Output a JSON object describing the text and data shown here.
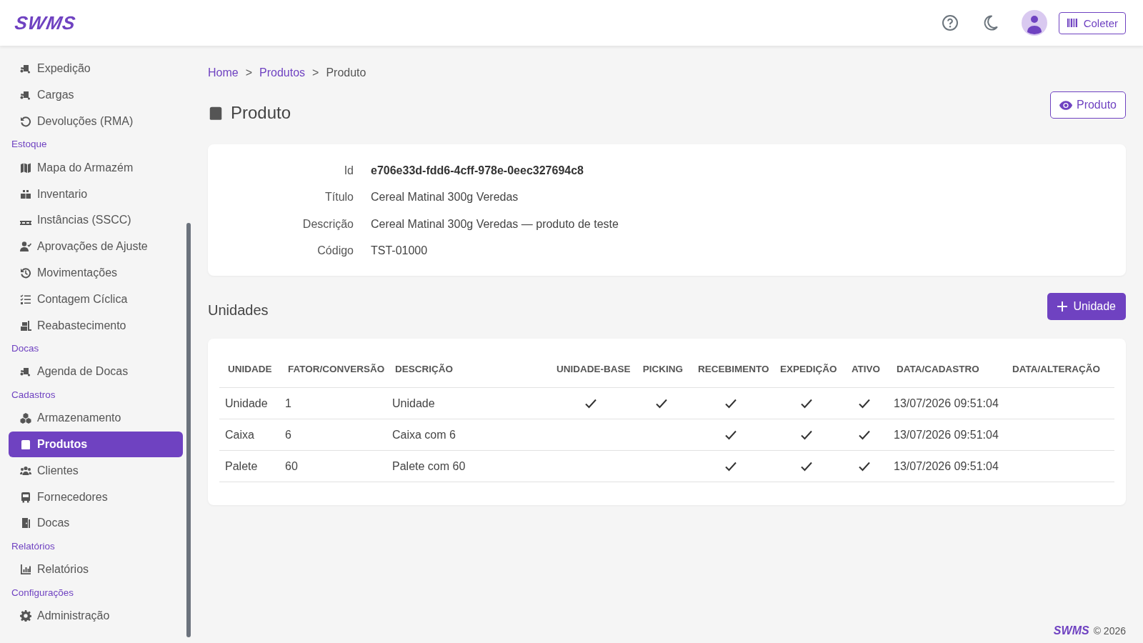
{
  "header": {
    "logo": "SWMS",
    "collector_button": "Coleter"
  },
  "sidebar": {
    "groups": [
      {
        "items": [
          {
            "label": "Expedição",
            "selected": false
          },
          {
            "label": "Cargas",
            "selected": false
          },
          {
            "label": "Devoluções (RMA)",
            "selected": false
          }
        ]
      },
      {
        "title": "Estoque",
        "items": [
          {
            "label": "Mapa do Armazém",
            "selected": false
          },
          {
            "label": "Inventario",
            "selected": false
          },
          {
            "label": "Instâncias (SSCC)",
            "selected": false
          },
          {
            "label": "Aprovações de Ajuste",
            "selected": false
          },
          {
            "label": "Movimentações",
            "selected": false
          },
          {
            "label": "Contagem Cíclica",
            "selected": false
          },
          {
            "label": "Reabastecimento",
            "selected": false
          }
        ]
      },
      {
        "title": "Docas",
        "items": [
          {
            "label": "Agenda de Docas",
            "selected": false
          }
        ]
      },
      {
        "title": "Cadastros",
        "items": [
          {
            "label": "Armazenamento",
            "selected": false
          },
          {
            "label": "Produtos",
            "selected": true
          },
          {
            "label": "Clientes",
            "selected": false
          },
          {
            "label": "Fornecedores",
            "selected": false
          },
          {
            "label": "Docas",
            "selected": false
          }
        ]
      },
      {
        "title": "Relatórios",
        "items": [
          {
            "label": "Relatórios",
            "selected": false
          }
        ]
      },
      {
        "title": "Configurações",
        "items": [
          {
            "label": "Administração",
            "selected": false
          }
        ]
      }
    ]
  },
  "breadcrumb": [
    {
      "kind": "link",
      "text": "Home"
    },
    {
      "kind": "separator",
      "text": ">"
    },
    {
      "kind": "link",
      "text": "Produtos"
    },
    {
      "kind": "separator",
      "text": ">"
    },
    {
      "kind": "current",
      "text": "Produto"
    }
  ],
  "page": {
    "title": "Produto",
    "view_button": "Produto"
  },
  "details": [
    {
      "label": "Id",
      "value": "e706e33d-fdd6-4cff-978e-0eec327694c8",
      "kind": "strong"
    },
    {
      "label": "Título",
      "value": "Cereal Matinal 300g Veredas",
      "kind": "plain"
    },
    {
      "label": "Descrição",
      "value": "Cereal Matinal 300g Veredas — produto de teste",
      "kind": "plain"
    },
    {
      "label": "Código",
      "value": "TST-01000",
      "kind": "plain"
    }
  ],
  "units": {
    "title": "Unidades",
    "add_button": "Unidade"
  },
  "table": {
    "columns": [
      "UNIDADE",
      "FATOR/CONVERSÃO",
      "DESCRIÇÃO",
      "UNIDADE-BASE",
      "PICKING",
      "RECEBIMENTO",
      "EXPEDIÇÃO",
      "ATIVO",
      "DATA/CADASTRO",
      "DATA/ALTERAÇÃO"
    ],
    "rows": [
      {
        "unidade": "Unidade",
        "fator": "1",
        "descricao": "Unidade",
        "unidade_base": true,
        "picking": true,
        "recebimento": true,
        "expedicao": true,
        "ativo": true,
        "data_cadastro": "13/07/2026 09:51:04"
      },
      {
        "unidade": "Caixa",
        "fator": "6",
        "descricao": "Caixa com 6",
        "unidade_base": false,
        "picking": false,
        "recebimento": true,
        "expedicao": true,
        "ativo": true,
        "data_cadastro": "13/07/2026 09:51:04"
      },
      {
        "unidade": "Palete",
        "fator": "60",
        "descricao": "Palete com 60",
        "unidade_base": false,
        "picking": false,
        "recebimento": true,
        "expedicao": true,
        "ativo": true,
        "data_cadastro": "13/07/2026 09:51:04"
      }
    ]
  },
  "footer": {
    "logo": "SWMS",
    "copyright": "© 2026"
  }
}
